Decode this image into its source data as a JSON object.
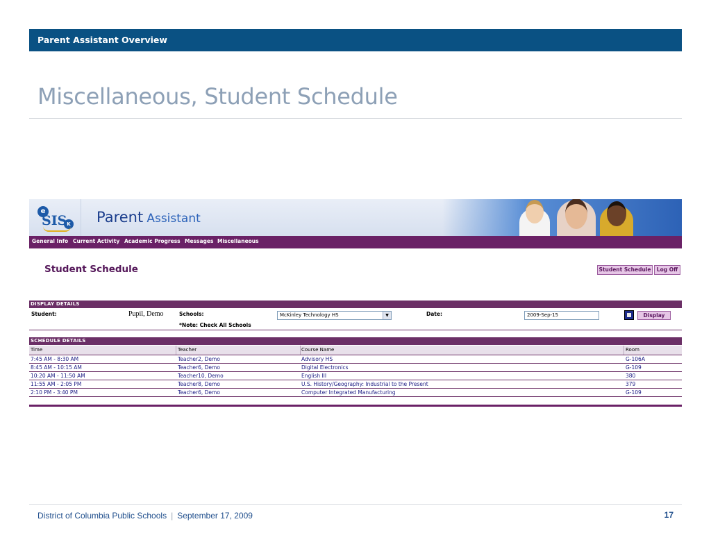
{
  "slide": {
    "header_title": "Parent Assistant Overview",
    "title": "Miscellaneous, Student Schedule",
    "footer_org": "District of Columbia Public Schools",
    "footer_sep": "|",
    "footer_date": "September 17, 2009",
    "page_number": "17"
  },
  "app": {
    "logo": {
      "e": "e",
      "sis": "SIS",
      "k": "K"
    },
    "brand_part1": "Parent",
    "brand_part2": "Assistant",
    "nav": [
      "General Info",
      "Current Activity",
      "Academic Progress",
      "Messages",
      "Miscellaneous"
    ],
    "page_title": "Student Schedule",
    "buttons": {
      "student_schedule": "Student Schedule",
      "log_off": "Log Off",
      "display": "Display"
    },
    "display_details": {
      "header": "DISPLAY DETAILS",
      "student_label": "Student:",
      "student_value": "Pupil, Demo",
      "schools_label": "Schools:",
      "schools_value": "McKinley Technology HS",
      "note": "*Note: Check All Schools",
      "date_label": "Date:",
      "date_value": "2009-Sep-15"
    },
    "schedule_details": {
      "header": "SCHEDULE DETAILS",
      "columns": [
        "Time",
        "Teacher",
        "Course Name",
        "Room"
      ],
      "rows": [
        [
          "7:45 AM -  8:30 AM",
          "Teacher2, Demo",
          "Advisory HS",
          "G-106A"
        ],
        [
          "8:45 AM -  10:15 AM",
          "Teacher6, Demo",
          "Digital Electronics",
          "G-109"
        ],
        [
          "10:20 AM -  11:50 AM",
          "Teacher10, Demo",
          "English III",
          "380"
        ],
        [
          "11:55 AM -  2:05 PM",
          "Teacher8, Demo",
          "U.S. History/Geography: Industrial to the Present",
          "379"
        ],
        [
          "2:10 PM -  3:40 PM",
          "Teacher6, Demo",
          "Computer Integrated Manufacturing",
          "G-109"
        ]
      ]
    },
    "colors": {
      "slide_bar": "#0a5183",
      "purple": "#6a2166",
      "link_text": "#1c1c84"
    }
  }
}
